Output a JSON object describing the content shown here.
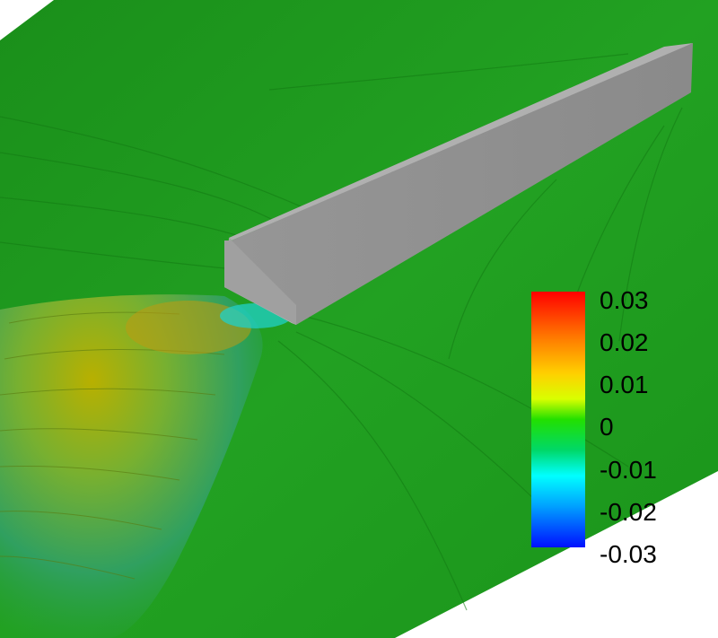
{
  "legend": {
    "labels": [
      "0.03",
      "0.02",
      "0.01",
      "0",
      "-0.01",
      "-0.02",
      "-0.03"
    ]
  },
  "colors": {
    "background": "#ffffff",
    "surface_green": "#1e9a1e",
    "wake_yellow": "#c8b400",
    "wake_cyan": "#00d0d0",
    "body_gray": "#a8a8a8"
  }
}
